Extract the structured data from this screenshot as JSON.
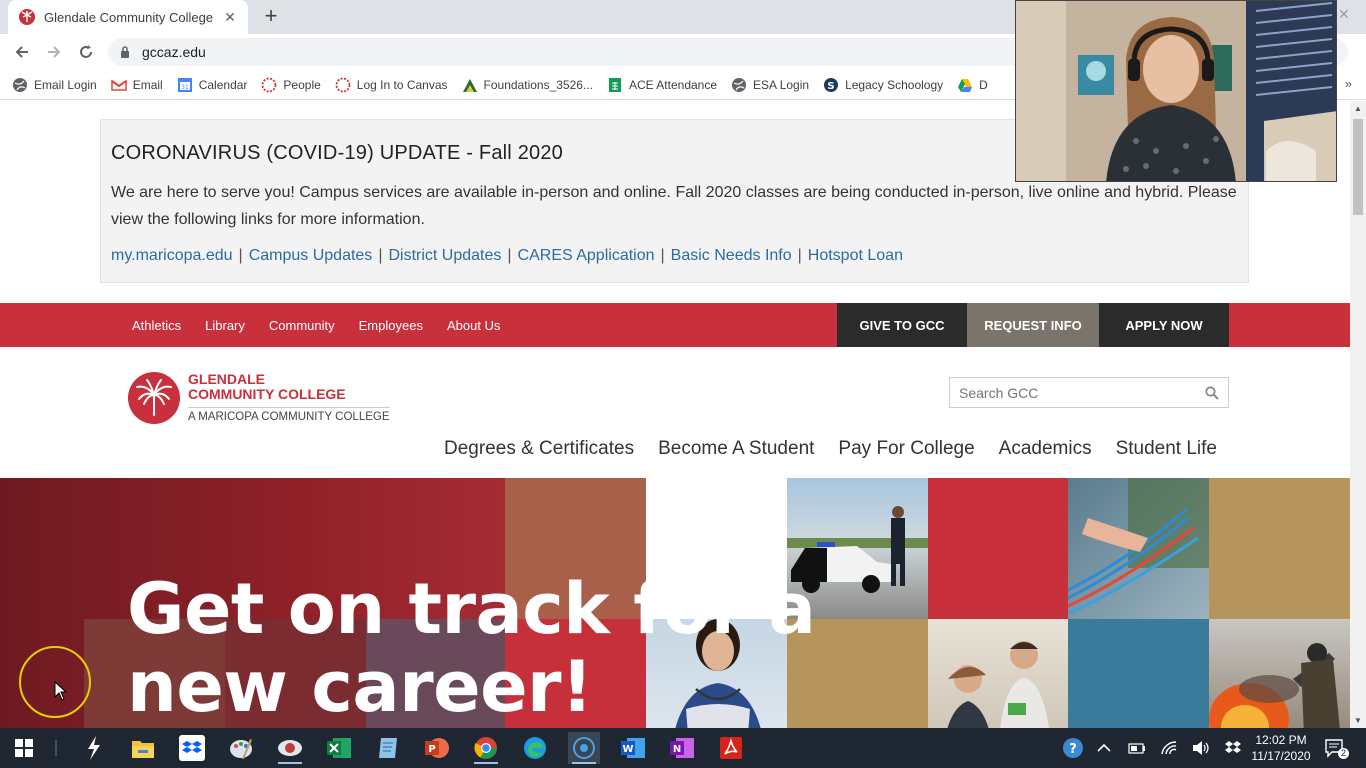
{
  "browser": {
    "tab_title": "Glendale Community College",
    "url": "gccaz.edu",
    "bookmarks": [
      {
        "label": "Email Login",
        "icon": "globe-icon"
      },
      {
        "label": "Email",
        "icon": "gmail-icon"
      },
      {
        "label": "Calendar",
        "icon": "calendar-icon"
      },
      {
        "label": "People",
        "icon": "canvas-icon"
      },
      {
        "label": "Log In to Canvas",
        "icon": "canvas-icon"
      },
      {
        "label": "Foundations_3526...",
        "icon": "foundations-icon"
      },
      {
        "label": "ACE Attendance",
        "icon": "sheets-icon"
      },
      {
        "label": "ESA Login",
        "icon": "globe-icon"
      },
      {
        "label": "Legacy Schoology",
        "icon": "schoology-icon"
      },
      {
        "label": "D",
        "icon": "drive-icon"
      }
    ],
    "more": "»"
  },
  "covid": {
    "heading": "CORONAVIRUS (COVID-19) UPDATE - Fall 2020",
    "body": "We are here to serve you! Campus services are available in-person and online. Fall 2020 classes are being conducted in-person, live online and hybrid. Please view the following links for more information.",
    "links": [
      "my.maricopa.edu",
      "Campus Updates",
      "District Updates",
      "CARES Application",
      "Basic Needs Info",
      "Hotspot Loan"
    ],
    "separator": "|"
  },
  "utility_nav": {
    "items": [
      "Athletics",
      "Library",
      "Community",
      "Employees",
      "About Us"
    ],
    "give": "GIVE TO GCC",
    "request": "REQUEST INFO",
    "apply": "APPLY NOW"
  },
  "header": {
    "logo_line1": "GLENDALE",
    "logo_line2": "COMMUNITY COLLEGE",
    "logo_line3": "A MARICOPA COMMUNITY COLLEGE",
    "search_placeholder": "Search GCC",
    "main_nav": [
      "Degrees & Certificates",
      "Become A Student",
      "Pay For College",
      "Academics",
      "Student Life"
    ]
  },
  "hero": {
    "headline_line1": "Get on track for a",
    "headline_line2": "new career!"
  },
  "taskbar": {
    "time": "12:02 PM",
    "date": "11/17/2020",
    "notification_count": "2",
    "apps": [
      "start-icon",
      "powershell-icon",
      "file-explorer-icon",
      "dropbox-icon",
      "paint-icon",
      "snagit-icon",
      "excel-icon",
      "notepad-icon",
      "powerpoint-icon",
      "chrome-icon",
      "edge-icon",
      "screen-recorder-icon",
      "word-icon",
      "onenote-icon",
      "acrobat-icon"
    ]
  },
  "colors": {
    "brand_red": "#c8303c",
    "link_blue": "#2e6a9f",
    "taskbar": "#1f2733"
  }
}
